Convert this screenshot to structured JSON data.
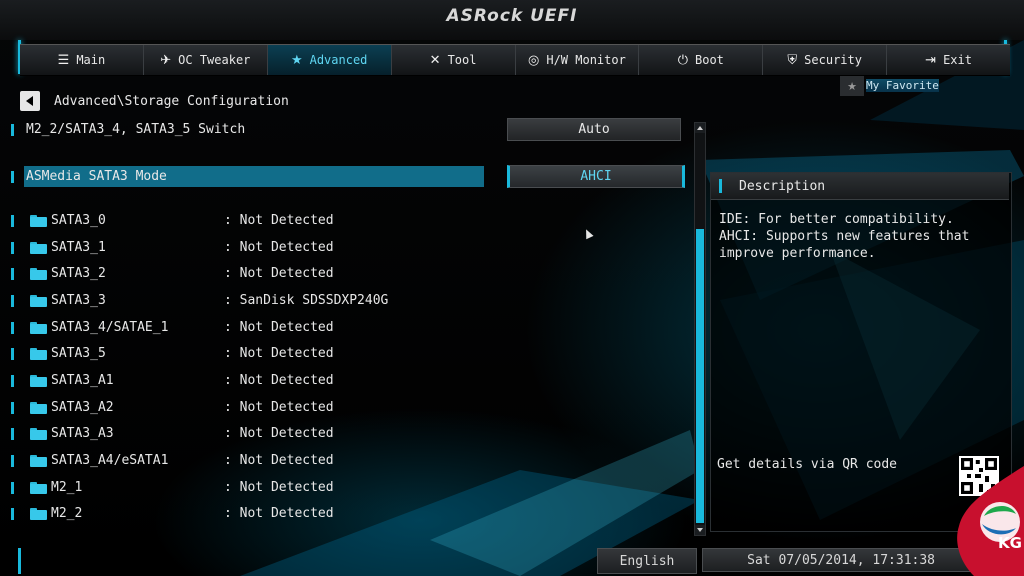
{
  "brand": {
    "logo": "ASRock UEFI"
  },
  "nav": {
    "tabs": [
      {
        "label": "Main",
        "icon": "list-icon",
        "glyph": "☰",
        "active": false
      },
      {
        "label": "OC Tweaker",
        "icon": "rocket-icon",
        "glyph": "✈",
        "active": false
      },
      {
        "label": "Advanced",
        "icon": "star-icon",
        "glyph": "★",
        "active": true
      },
      {
        "label": "Tool",
        "icon": "tools-icon",
        "glyph": "✕",
        "active": false
      },
      {
        "label": "H/W Monitor",
        "icon": "monitor-icon",
        "glyph": "◎",
        "active": false
      },
      {
        "label": "Boot",
        "icon": "power-icon",
        "glyph": "⏻",
        "active": false
      },
      {
        "label": "Security",
        "icon": "shield-icon",
        "glyph": "⛨",
        "active": false
      },
      {
        "label": "Exit",
        "icon": "exit-icon",
        "glyph": "⇥",
        "active": false
      }
    ]
  },
  "favorite": {
    "label": "My Favorite",
    "icon": "star-icon"
  },
  "breadcrumb": {
    "path": "Advanced\\Storage Configuration"
  },
  "settings": {
    "switch": {
      "label": "M2_2/SATA3_4, SATA3_5 Switch",
      "value": "Auto"
    },
    "mode": {
      "label": "ASMedia SATA3 Mode",
      "value": "AHCI"
    }
  },
  "devices": [
    {
      "port": "SATA3_0",
      "status": ": Not Detected"
    },
    {
      "port": "SATA3_1",
      "status": ": Not Detected"
    },
    {
      "port": "SATA3_2",
      "status": ": Not Detected"
    },
    {
      "port": "SATA3_3",
      "status": ": SanDisk SDSSDXP240G"
    },
    {
      "port": "SATA3_4/SATAE_1",
      "status": ": Not Detected"
    },
    {
      "port": "SATA3_5",
      "status": ": Not Detected"
    },
    {
      "port": "SATA3_A1",
      "status": ": Not Detected"
    },
    {
      "port": "SATA3_A2",
      "status": ": Not Detected"
    },
    {
      "port": "SATA3_A3",
      "status": ": Not Detected"
    },
    {
      "port": "SATA3_A4/eSATA1",
      "status": ": Not Detected"
    },
    {
      "port": "M2_1",
      "status": ": Not Detected"
    },
    {
      "port": "M2_2",
      "status": ": Not Detected"
    }
  ],
  "description": {
    "title": "Description",
    "lines": [
      "IDE: For better compatibility.",
      "AHCI: Supports new features that",
      "improve performance."
    ],
    "qr_text": "Get details via QR code"
  },
  "footer": {
    "language": "English",
    "datetime": "Sat 07/05/2014, 17:31:38"
  },
  "watermark": {
    "text": "KG"
  },
  "colors": {
    "accent": "#19b9dc",
    "highlight": "#116d8a",
    "active_tab": "#0b3f52"
  }
}
